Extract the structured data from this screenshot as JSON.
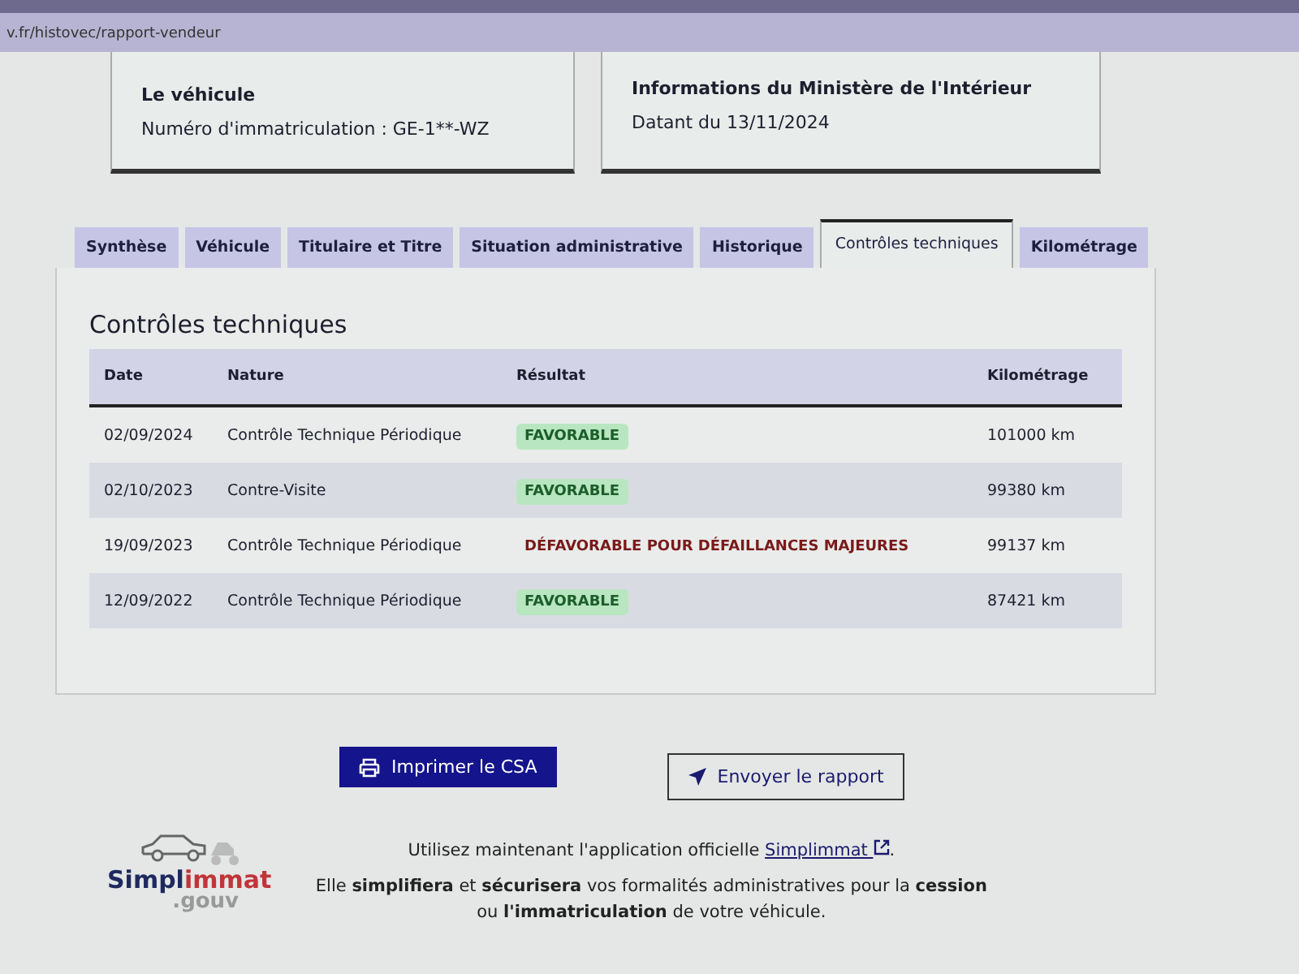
{
  "browser": {
    "address": "v.fr/histovec/rapport-vendeur"
  },
  "cards": [
    {
      "title": "Le véhicule",
      "text": "Numéro d'immatriculation : GE-1**-WZ"
    },
    {
      "title": "Informations du Ministère de l'Intérieur",
      "text": "Datant du 13/11/2024"
    }
  ],
  "tabs": [
    {
      "label": "Synthèse",
      "selected": false
    },
    {
      "label": "Véhicule",
      "selected": false
    },
    {
      "label": "Titulaire et Titre",
      "selected": false
    },
    {
      "label": "Situation administrative",
      "selected": false
    },
    {
      "label": "Historique",
      "selected": false
    },
    {
      "label": "Contrôles techniques",
      "selected": true
    },
    {
      "label": "Kilométrage",
      "selected": false
    }
  ],
  "section_title": "Contrôles techniques",
  "table": {
    "columns": [
      "Date",
      "Nature",
      "Résultat",
      "Kilométrage"
    ],
    "rows": [
      {
        "date": "02/09/2024",
        "nature": "Contrôle Technique Périodique",
        "result": "FAVORABLE",
        "kind": "favorable",
        "km": "101000 km"
      },
      {
        "date": "02/10/2023",
        "nature": "Contre-Visite",
        "result": "FAVORABLE",
        "kind": "favorable",
        "km": "99380 km"
      },
      {
        "date": "19/09/2023",
        "nature": "Contrôle Technique Périodique",
        "result": "DÉFAVORABLE POUR DÉFAILLANCES MAJEURES",
        "kind": "defavorable",
        "km": "99137 km"
      },
      {
        "date": "12/09/2022",
        "nature": "Contrôle Technique Périodique",
        "result": "FAVORABLE",
        "kind": "favorable",
        "km": "87421 km"
      }
    ]
  },
  "buttons": {
    "print": "Imprimer le CSA",
    "send": "Envoyer le rapport"
  },
  "logo": {
    "part_a": "Simpl",
    "part_b": "immat",
    "suffix": ".gouv"
  },
  "footer": {
    "before": "Utilisez maintenant l'application officielle ",
    "link": "Simplimmat",
    "after": ".",
    "paragraph": "Elle **simplifiera** et **sécurisera** vos formalités administratives pour la **cession** ou **l'immatriculation** de votre véhicule."
  }
}
